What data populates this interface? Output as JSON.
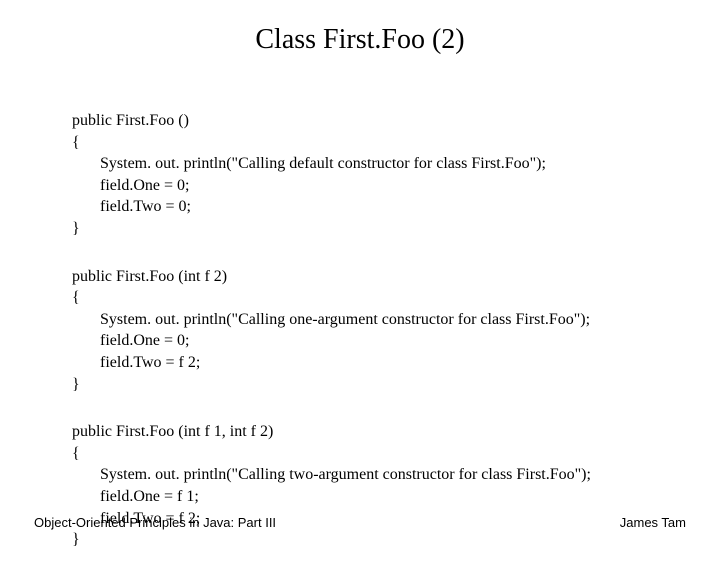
{
  "title": "Class First.Foo (2)",
  "blocks": [
    {
      "sig": "public First.Foo ()",
      "open": "{",
      "l1": "System. out. println(\"Calling default constructor for class First.Foo\");",
      "l2": "field.One = 0;",
      "l3": "field.Two = 0;",
      "close": "}"
    },
    {
      "sig": "public First.Foo (int f 2)",
      "open": "{",
      "l1": "System. out. println(\"Calling one-argument constructor for class First.Foo\");",
      "l2": "field.One = 0;",
      "l3": "field.Two = f 2;",
      "close": "}"
    },
    {
      "sig": "public First.Foo (int f 1, int f 2)",
      "open": "{",
      "l1": "System. out. println(\"Calling two-argument constructor for class First.Foo\");",
      "l2": "field.One = f 1;",
      "l3": "field.Two = f 2;",
      "close": "}"
    }
  ],
  "footer": {
    "left": "Object-Oriented Principles in Java: Part III",
    "right": "James Tam"
  }
}
